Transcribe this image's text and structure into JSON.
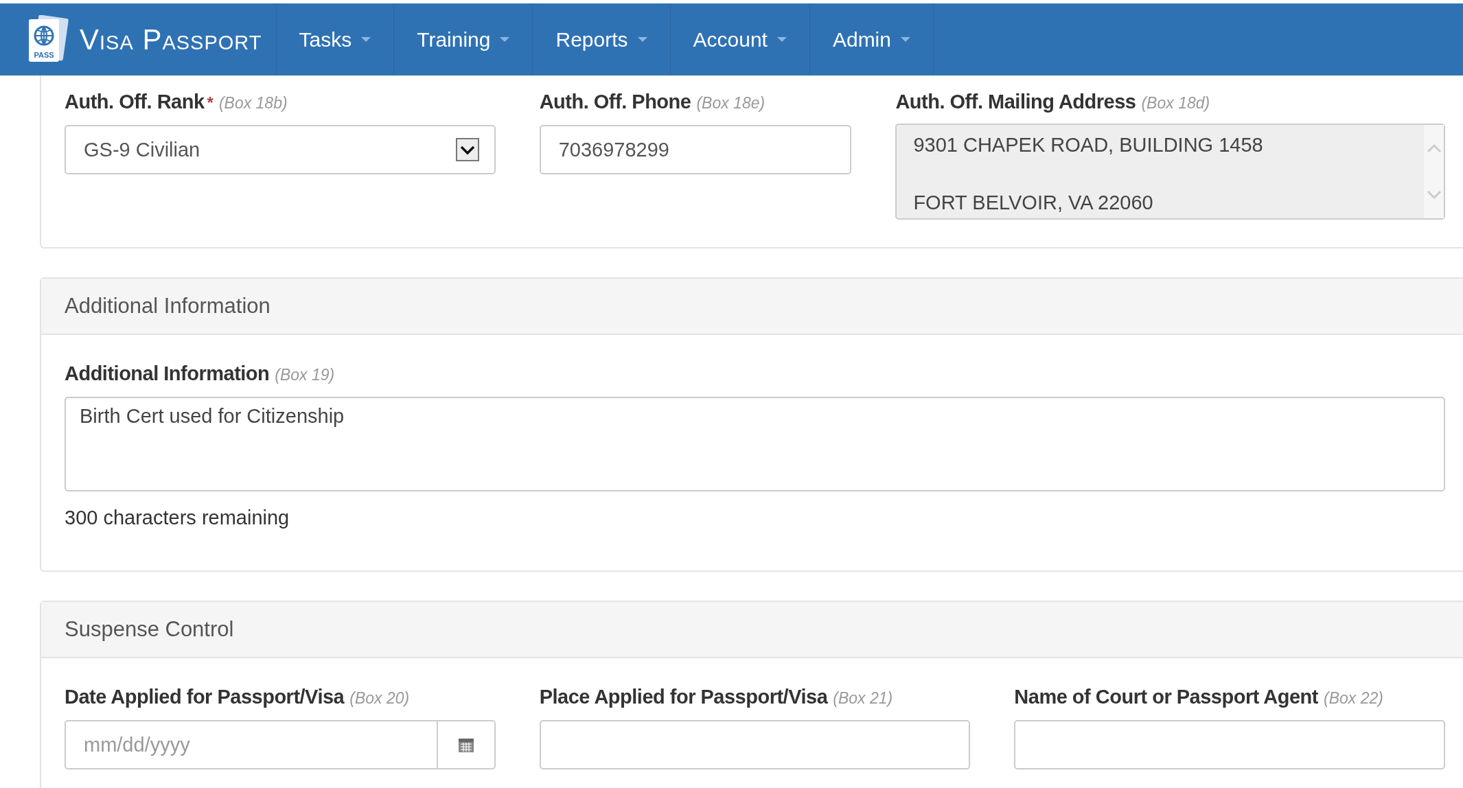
{
  "navbar": {
    "brand": "Visa Passport",
    "logo_text": "PASS",
    "menus": [
      {
        "label": "Tasks"
      },
      {
        "label": "Training"
      },
      {
        "label": "Reports"
      },
      {
        "label": "Account"
      },
      {
        "label": "Admin"
      }
    ]
  },
  "sections": [
    {
      "fields": [
        {
          "kind": "select",
          "label": "Auth. Off. Rank",
          "required_mark": "*",
          "hint": "(Box 18b)",
          "value": "GS-9 Civilian"
        },
        {
          "kind": "input",
          "label": "Auth. Off. Phone",
          "hint": "(Box 18e)",
          "value": "7036978299"
        },
        {
          "kind": "address",
          "label": "Auth. Off. Mailing Address",
          "hint": "(Box 18d)",
          "value": "9301 CHAPEK ROAD, BUILDING 1458\n\nFORT BELVOIR, VA 22060",
          "disabled": true
        }
      ]
    },
    {
      "heading": "Additional Information",
      "fields": [
        {
          "kind": "textarea",
          "label": "Additional Information",
          "hint": "(Box 19)",
          "value": "Birth Cert used for Citizenship",
          "counter": "300 characters remaining"
        }
      ]
    },
    {
      "heading": "Suspense Control",
      "fields": [
        {
          "kind": "date",
          "label": "Date Applied for Passport/Visa",
          "hint": "(Box 20)",
          "placeholder": "mm/dd/yyyy"
        },
        {
          "kind": "input",
          "label": "Place Applied for Passport/Visa",
          "hint": "(Box 21)"
        },
        {
          "kind": "input",
          "label": "Name of Court or Passport Agent",
          "hint": "(Box 22)"
        }
      ]
    }
  ]
}
